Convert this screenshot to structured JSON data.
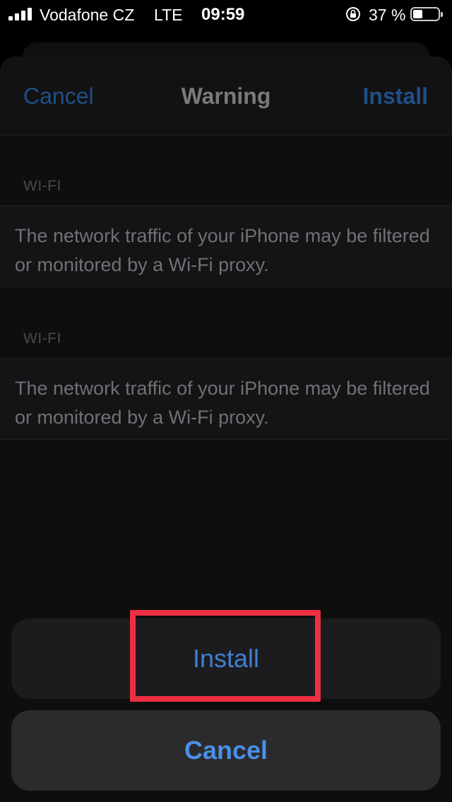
{
  "status_bar": {
    "carrier": "Vodafone CZ",
    "network": "LTE",
    "time": "09:59",
    "battery_percent": "37 %",
    "battery_level": 0.37
  },
  "navbar": {
    "cancel_label": "Cancel",
    "title": "Warning",
    "install_label": "Install"
  },
  "sections": [
    {
      "header": "WI-FI",
      "text": "The network traffic of your iPhone may be filtered or monitored by a Wi-Fi proxy."
    },
    {
      "header": "WI-FI",
      "text": "The network traffic of your iPhone may be filtered or monitored by a Wi-Fi proxy."
    }
  ],
  "action_sheet": {
    "install_label": "Install",
    "cancel_label": "Cancel"
  },
  "colors": {
    "accent": "#4a90e8",
    "highlight": "#ee2f43"
  }
}
